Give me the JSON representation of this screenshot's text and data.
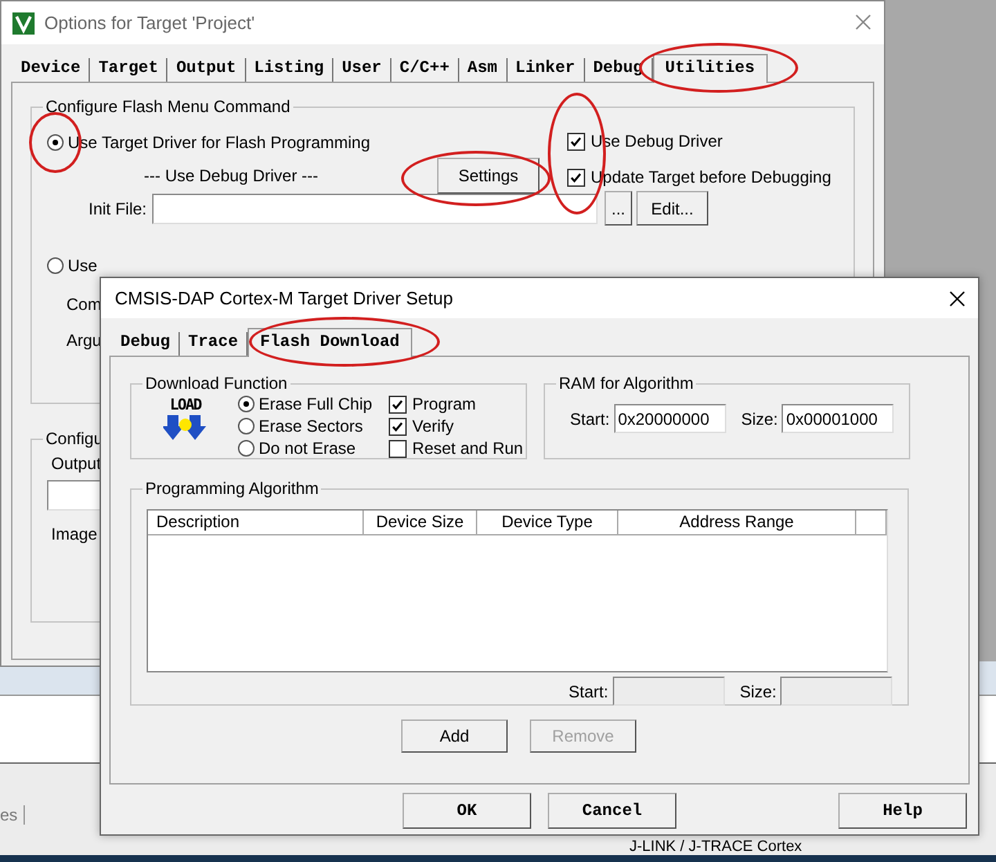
{
  "options_window": {
    "title": "Options for Target 'Project'",
    "tabs": [
      {
        "label": "Device",
        "selected": false,
        "circled": false
      },
      {
        "label": "Target",
        "selected": false,
        "circled": false
      },
      {
        "label": "Output",
        "selected": false,
        "circled": false
      },
      {
        "label": "Listing",
        "selected": false,
        "circled": false
      },
      {
        "label": "User",
        "selected": false,
        "circled": false
      },
      {
        "label": "C/C++",
        "selected": false,
        "circled": false
      },
      {
        "label": "Asm",
        "selected": false,
        "circled": false
      },
      {
        "label": "Linker",
        "selected": false,
        "circled": false
      },
      {
        "label": "Debug",
        "selected": false,
        "circled": false
      },
      {
        "label": "Utilities",
        "selected": true,
        "circled": true
      }
    ],
    "flash_group": {
      "title": "Configure Flash Menu Command",
      "target_driver": {
        "label": "Use Target Driver for Flash Programming",
        "selected": true,
        "circled": true
      },
      "debug_driver_note": "--- Use Debug Driver ---",
      "settings_button": {
        "label": "Settings",
        "circled": true
      },
      "checks": {
        "circled": true,
        "items": [
          {
            "label": "Use Debug Driver",
            "checked": true
          },
          {
            "label": "Update Target before Debugging",
            "checked": true
          }
        ]
      },
      "init_file": {
        "label": "Init File:",
        "browse_button": "...",
        "edit_button": "Edit..."
      },
      "external_tool": {
        "label": "Use",
        "selected": false
      },
      "command_label": "Com",
      "arguments_label": "Argu"
    },
    "output_group": {
      "title": "Configu",
      "output_label": "Output",
      "image_label": "Image"
    }
  },
  "driver_dialog": {
    "title": "CMSIS-DAP Cortex-M Target Driver Setup",
    "tabs": [
      {
        "label": "Debug",
        "selected": false,
        "circled": false
      },
      {
        "label": "Trace",
        "selected": false,
        "circled": false
      },
      {
        "label": "Flash Download",
        "selected": true,
        "circled": true
      }
    ],
    "download_function": {
      "title": "Download Function",
      "icon_label": "LOAD",
      "erase_options": [
        {
          "label": "Erase Full Chip",
          "selected": true
        },
        {
          "label": "Erase Sectors",
          "selected": false
        },
        {
          "label": "Do not Erase",
          "selected": false
        }
      ],
      "checks": [
        {
          "label": "Program",
          "checked": true
        },
        {
          "label": "Verify",
          "checked": true
        },
        {
          "label": "Reset and Run",
          "checked": false
        }
      ]
    },
    "ram": {
      "title": "RAM for Algorithm",
      "start_label": "Start:",
      "start_value": "0x20000000",
      "size_label": "Size:",
      "size_value": "0x00001000"
    },
    "algorithm": {
      "title": "Programming Algorithm",
      "columns": [
        "Description",
        "Device Size",
        "Device Type",
        "Address Range"
      ],
      "start_label": "Start:",
      "size_label": "Size:",
      "fields_disabled": true
    },
    "list_buttons": [
      {
        "label": "Add",
        "disabled": false
      },
      {
        "label": "Remove",
        "disabled": true
      }
    ],
    "footer_buttons": [
      {
        "label": "OK"
      },
      {
        "label": "Cancel"
      },
      {
        "label": "Help"
      }
    ]
  },
  "background_app": {
    "tab_fragment": "es",
    "footer_text": "J-LINK / J-TRACE Cortex"
  }
}
